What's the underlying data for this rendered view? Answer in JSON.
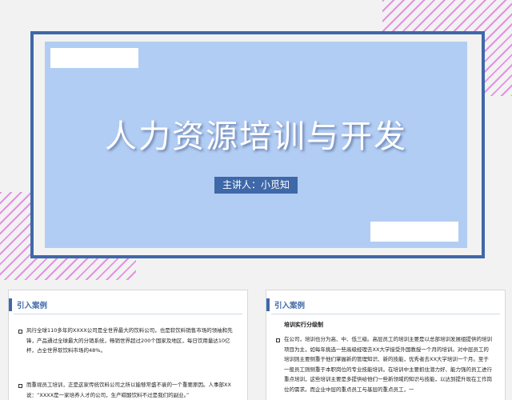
{
  "slide": {
    "title": "人力资源培训与开发",
    "presenter": "主讲人：小觅知"
  },
  "thumbnails": [
    {
      "heading": "引入案例",
      "subheading": "",
      "paragraphs": [
        "风行全球110多年的XXXX公司是全世界最大的饮料公司，也是软饮料销售市场的领袖和先锋，产品通过全球最大的分销系统，畅销世界超过200个国家及地区，每日饮用量达10亿杯，占全世界软饮料市场的48%。",
        "而重视员工培训，正是这家传统饮料公司之所以能够常盛不衰的一个重要原因。人事部XX说：“XXXX是一家培养人才的公司，生产碳酸饮料不过是我们的副业。”"
      ]
    },
    {
      "heading": "引入案例",
      "subheading": "培训实行分级制",
      "paragraphs": [
        "在公司，培训也分为高、中、低三级。高层员工的培训主要是以总部培训发展组提供的培训项目为主，如每年挑选一些高级经理去XX大学接受外国教授一个月的培训。对中层员工的培训则主要侧重于他们掌握新的管理知识、新的技能，优秀者去XX大学培训一个月。至于一般员工则侧重于本职岗位的专业技能培训。在培训中主要抓住潜力好、能力强的员工进行重点培训，这些培训主要是多提供给他们一些新领域的知识与技能，以达到提升现在工作岗位的需求。而企业中层的重点员工与基层的重点员工，一"
      ]
    }
  ]
}
